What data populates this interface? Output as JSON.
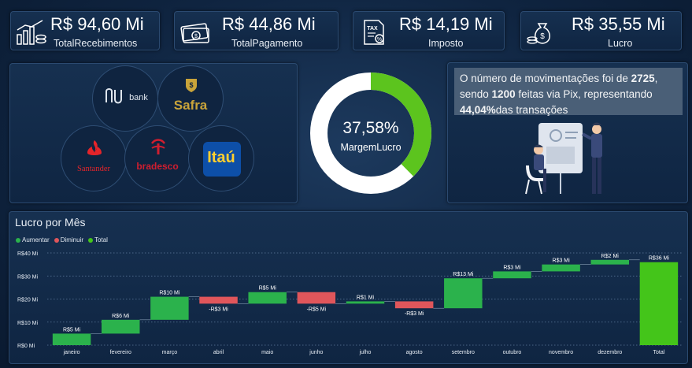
{
  "kpis": [
    {
      "value": "R$ 94,60 Mi",
      "label": "TotalRecebimentos",
      "icon": "bar-growth-coins-icon"
    },
    {
      "value": "R$ 44,86 Mi",
      "label": "TotalPagamento",
      "icon": "cash-payment-icon"
    },
    {
      "value": "R$ 14,19 Mi",
      "label": "Imposto",
      "icon": "tax-document-icon"
    },
    {
      "value": "R$ 35,55 Mi",
      "label": "Lucro",
      "icon": "money-bag-icon"
    }
  ],
  "banks": {
    "nubank": "bank",
    "safra": "Safra",
    "santander": "Santander",
    "bradesco": "bradesco",
    "itau": "Itaú"
  },
  "donut": {
    "value_label": "37,58%",
    "caption": "MargemLucro",
    "fraction": 0.3758,
    "color_filled": "#5cc41e",
    "color_rest": "#ffffff"
  },
  "info": {
    "text1": "O número de movimentações foi de ",
    "count": "2725",
    "text2": ", sendo ",
    "pix": "1200",
    "text3": " feitas via Pix, representando ",
    "pct": "44,04%",
    "text4": "das transações"
  },
  "chart_section": {
    "title": "Lucro por Mês",
    "legend": [
      {
        "label": "Aumentar",
        "color": "#2bb24c"
      },
      {
        "label": "Diminuir",
        "color": "#e0565b"
      },
      {
        "label": "Total",
        "color": "#44c51a"
      }
    ]
  },
  "chart_data": {
    "type": "bar",
    "subtype": "waterfall",
    "title": "Lucro por Mês",
    "categories": [
      "janeiro",
      "fevereiro",
      "março",
      "abril",
      "maio",
      "junho",
      "julho",
      "agosto",
      "setembro",
      "outubro",
      "novembro",
      "dezembro",
      "Total"
    ],
    "values": [
      5,
      6,
      10,
      -3,
      5,
      -5,
      1,
      -3,
      13,
      3,
      3,
      2,
      36
    ],
    "data_labels": [
      "R$5 Mi",
      "R$6 Mi",
      "R$10 Mi",
      "-R$3 Mi",
      "R$5 Mi",
      "-R$5 Mi",
      "R$1 Mi",
      "-R$3 Mi",
      "R$13 Mi",
      "R$3 Mi",
      "R$3 Mi",
      "R$2 Mi",
      "R$36 Mi"
    ],
    "y_ticks": [
      {
        "value": 0,
        "label": "R$0 Mi"
      },
      {
        "value": 10,
        "label": "R$10 Mi"
      },
      {
        "value": 20,
        "label": "R$20 Mi"
      },
      {
        "value": 30,
        "label": "R$30 Mi"
      },
      {
        "value": 40,
        "label": "R$40 Mi"
      }
    ],
    "ylim": [
      0,
      40
    ],
    "colors": {
      "increase": "#2bb24c",
      "decrease": "#e0565b",
      "total": "#44c51a"
    },
    "legend": [
      "Aumentar",
      "Diminuir",
      "Total"
    ],
    "legend_position": "top-left",
    "grid": true
  }
}
